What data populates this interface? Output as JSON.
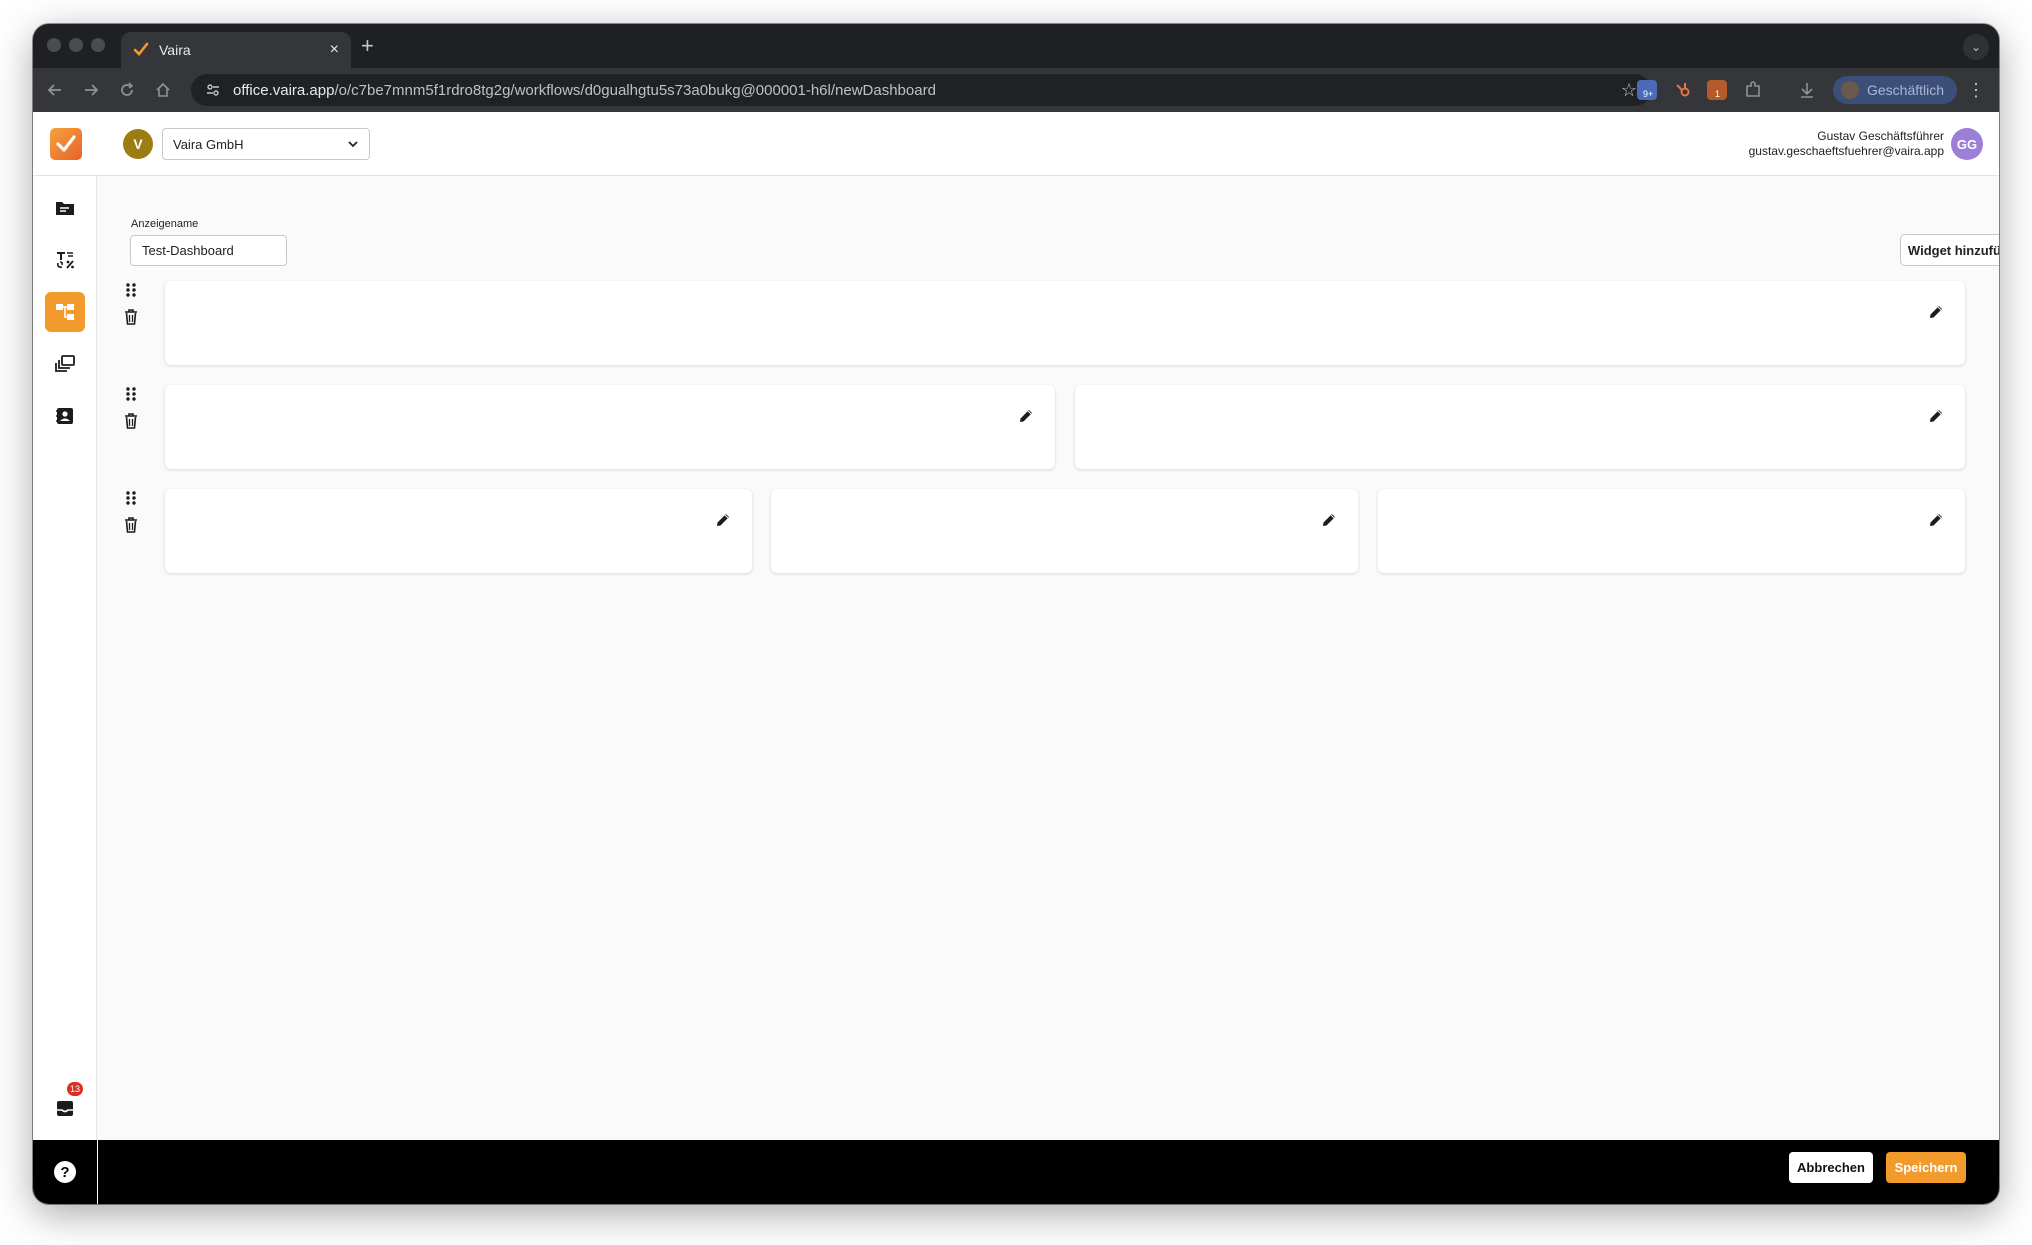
{
  "browser": {
    "tab_title": "Vaira",
    "tab_close": "×",
    "new_tab": "+",
    "tab_menu": "⌄",
    "url_host": "office.vaira.app",
    "url_path": "/o/c7be7mnm5f1rdro8tg2g/workflows/d0gualhgtu5s73a0bukg@000001-h6l/newDashboard",
    "profile_name": "Geschäftlich",
    "extension_badge_1": "9+",
    "extension_badge_2": "1",
    "colors": {
      "chrome_bg": "#1f2023",
      "toolbar_bg": "#35363a",
      "profile_bg": "#3c4f78"
    }
  },
  "header": {
    "org_avatar_letter": "V",
    "org_name": "Vaira GmbH",
    "user_name": "Gustav Geschäftsführer",
    "user_email": "gustav.geschaeftsfuehrer@vaira.app",
    "user_initials": "GG"
  },
  "sidebar": {
    "items": [
      {
        "name": "documents-icon",
        "active": false
      },
      {
        "name": "tax-rules-icon",
        "active": false
      },
      {
        "name": "workflows-icon",
        "active": true
      },
      {
        "name": "library-icon",
        "active": false
      },
      {
        "name": "contacts-icon",
        "active": false
      }
    ],
    "inbox_badge": "13",
    "help_label": "?"
  },
  "form": {
    "display_name_label": "Anzeigename",
    "display_name_value": "Test-Dashboard",
    "add_widget_label": "Widget hinzufügen"
  },
  "layout_rows": [
    {
      "widgets": 1
    },
    {
      "widgets": 2
    },
    {
      "widgets": 3
    }
  ],
  "footer": {
    "cancel_label": "Abbrechen",
    "save_label": "Speichern"
  },
  "colors": {
    "accent": "#f39a2c",
    "org_avatar": "#9b7d12",
    "user_avatar": "#9c7fd6"
  }
}
